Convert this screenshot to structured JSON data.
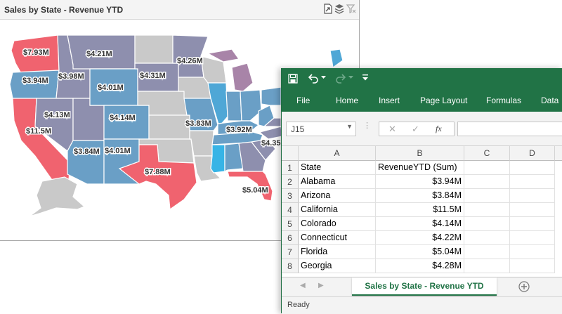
{
  "map_panel": {
    "title": "Sales by State - Revenue YTD",
    "icons": [
      "export-icon",
      "layers-icon",
      "clear-filter-icon"
    ],
    "revenue_labels": {
      "washington": "$7.93M",
      "montana": "$4.21M",
      "oregon": "$3.94M",
      "idaho": "$3.98M",
      "wyoming": "$4.01M",
      "south_dakota": "$4.31M",
      "minnesota": "$4.26M",
      "nevada": "$4.13M",
      "colorado": "$4.14M",
      "california": "$11.5M",
      "missouri": "$3.83M",
      "ohio_west_virginia": "$3.92M",
      "arizona": "$3.84M",
      "new_mexico": "$4.01M",
      "texas": "$7.88M",
      "florida": "$5.04M",
      "virginia_partial": "$4.35"
    },
    "colors": {
      "high": "#f0636f",
      "medium_purple": "#8e8fae",
      "medium_blue": "#6a9fc6",
      "bright_blue": "#4fa7d6",
      "cyan": "#37b4e6",
      "mauve": "#a884a8",
      "no_data": "#c9c9c9"
    }
  },
  "excel": {
    "quick_access": {
      "save_icon": "save-icon",
      "undo_icon": "undo-icon",
      "redo_icon": "redo-icon",
      "customize_icon": "customize-qat-icon"
    },
    "ribbon_tabs": [
      "File",
      "Home",
      "Insert",
      "Page Layout",
      "Formulas",
      "Data"
    ],
    "name_box": "J15",
    "formula_buttons": {
      "cancel": "✕",
      "enter": "✓",
      "fx": "fx"
    },
    "columns": [
      "A",
      "B",
      "C",
      "D"
    ],
    "rows": [
      {
        "n": "1",
        "a": "State",
        "b": "RevenueYTD (Sum)"
      },
      {
        "n": "2",
        "a": "Alabama",
        "b": "$3.94M"
      },
      {
        "n": "3",
        "a": "Arizona",
        "b": "$3.84M"
      },
      {
        "n": "4",
        "a": "California",
        "b": "$11.5M"
      },
      {
        "n": "5",
        "a": "Colorado",
        "b": "$4.14M"
      },
      {
        "n": "6",
        "a": "Connecticut",
        "b": "$4.22M"
      },
      {
        "n": "7",
        "a": "Florida",
        "b": "$5.04M"
      },
      {
        "n": "8",
        "a": "Georgia",
        "b": "$4.28M"
      }
    ],
    "sheet_tab": "Sales by State - Revenue YTD",
    "status": "Ready",
    "accent_color": "#217346"
  }
}
